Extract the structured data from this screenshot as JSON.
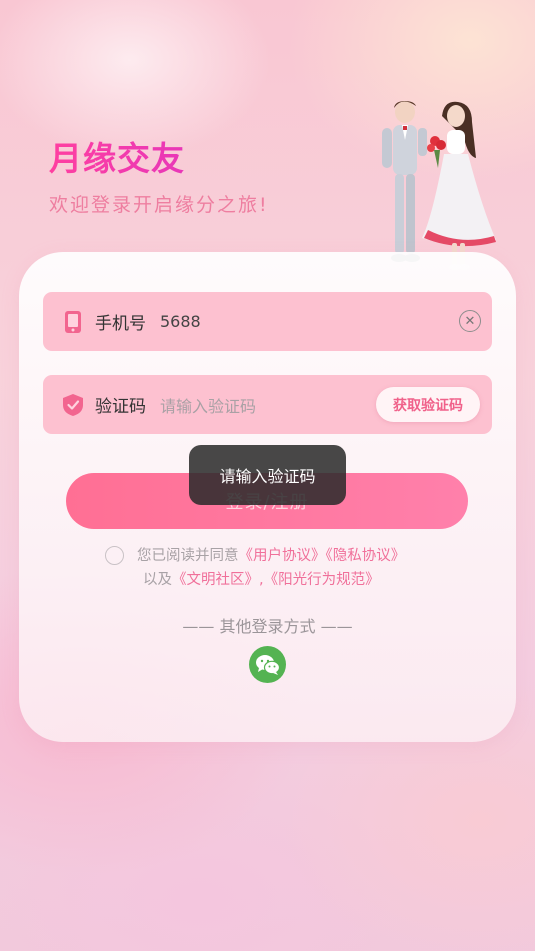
{
  "brand": {
    "title": "月缘交友",
    "subtitle": "欢迎登录开启缘分之旅!"
  },
  "form": {
    "phone": {
      "label": "手机号",
      "value": "5688",
      "icon": "phone-icon"
    },
    "code": {
      "label": "验证码",
      "placeholder": "请输入验证码",
      "icon": "shield-icon",
      "get_code_label": "获取验证码"
    },
    "submit_label": "登录/注册"
  },
  "toast": {
    "text": "请输入验证码"
  },
  "agreement": {
    "prefix": "您已阅读并同意",
    "user_agreement": "《用户协议》",
    "privacy_agreement": "《隐私协议》",
    "and": "以及",
    "community_rules": "《文明社区》",
    "separator": ",",
    "conduct_rules": "《阳光行为规范》"
  },
  "other_login": {
    "label": "—— 其他登录方式 ——",
    "wechat_icon": "wechat-icon"
  },
  "colors": {
    "accent": "#f0389a",
    "field_bg": "#fdc1d0",
    "button": "#ff7698",
    "link": "#f0709a",
    "wechat": "#54b352"
  }
}
